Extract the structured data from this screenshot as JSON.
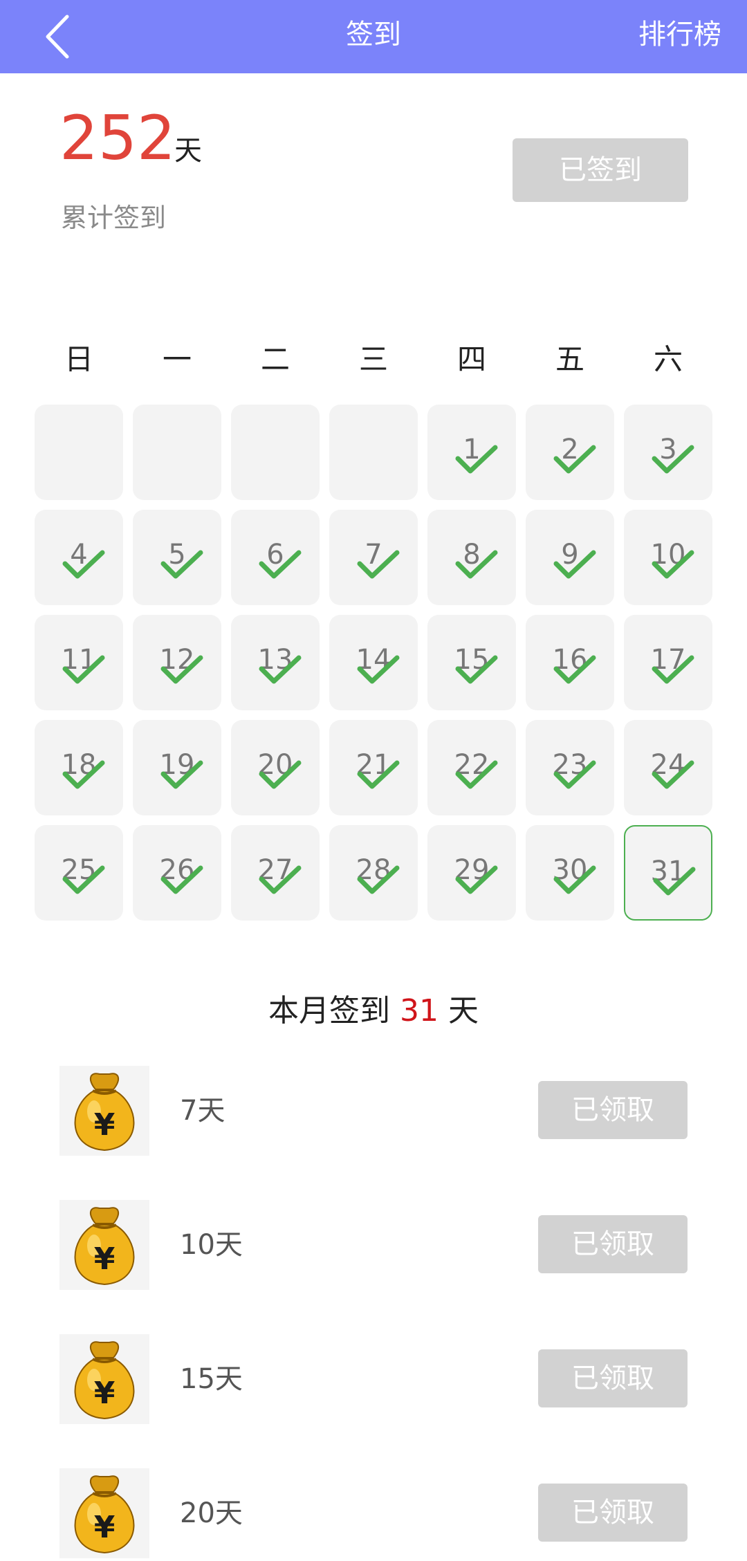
{
  "header": {
    "title": "签到",
    "right_link": "排行榜"
  },
  "summary": {
    "total_days": "252",
    "unit": "天",
    "label": "累计签到",
    "signed_button": "已签到"
  },
  "weekdays": [
    "日",
    "一",
    "二",
    "三",
    "四",
    "五",
    "六"
  ],
  "calendar": {
    "leading_blanks": 4,
    "days": [
      "1",
      "2",
      "3",
      "4",
      "5",
      "6",
      "7",
      "8",
      "9",
      "10",
      "11",
      "12",
      "13",
      "14",
      "15",
      "16",
      "17",
      "18",
      "19",
      "20",
      "21",
      "22",
      "23",
      "24",
      "25",
      "26",
      "27",
      "28",
      "29",
      "30",
      "31"
    ],
    "signed_all": true,
    "today": "31",
    "check_color": "#4caf50"
  },
  "month_summary": {
    "prefix": "本月签到",
    "count": "31",
    "suffix": "天"
  },
  "rewards": [
    {
      "label": "7天",
      "button": "已领取"
    },
    {
      "label": "10天",
      "button": "已领取"
    },
    {
      "label": "15天",
      "button": "已领取"
    },
    {
      "label": "20天",
      "button": "已领取"
    }
  ],
  "colors": {
    "header_bg": "#7b83fa",
    "accent_red": "#e0443a",
    "disabled_btn": "#d2d2d2"
  }
}
